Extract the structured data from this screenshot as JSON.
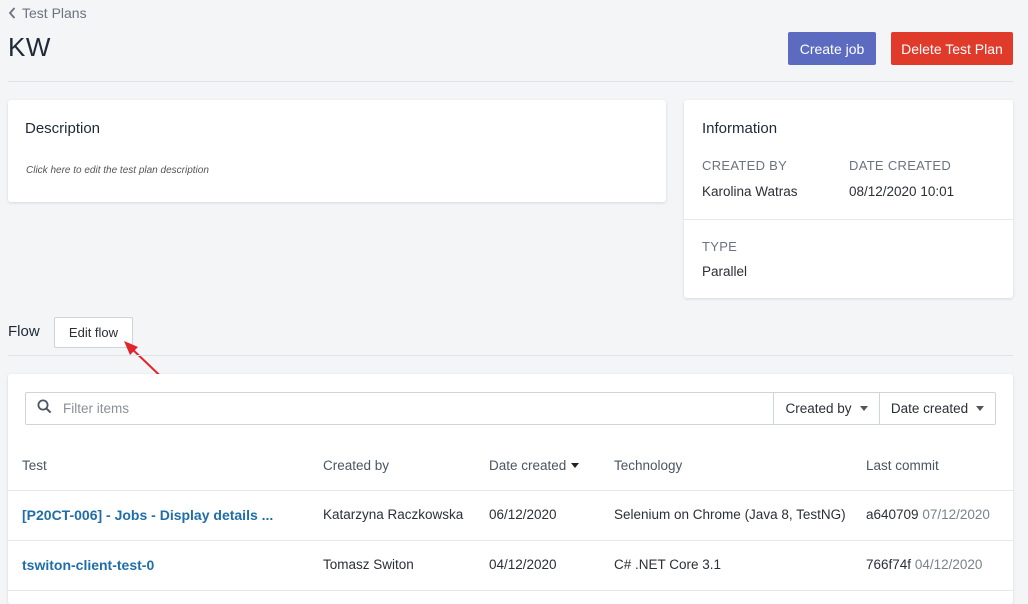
{
  "breadcrumb": {
    "label": "Test Plans"
  },
  "page": {
    "title": "KW"
  },
  "actions": {
    "create_job": "Create job",
    "delete_plan": "Delete Test Plan"
  },
  "colors": {
    "primary": "#5c6bc0",
    "danger": "#e03a2a",
    "link": "#1f6ea8",
    "annotation_arrow": "#e0252d"
  },
  "description": {
    "title": "Description",
    "hint": "Click here to edit the test plan description"
  },
  "information": {
    "title": "Information",
    "created_by_label": "CREATED BY",
    "created_by_value": "Karolina Watras",
    "date_created_label": "DATE CREATED",
    "date_created_value": "08/12/2020 10:01",
    "type_label": "TYPE",
    "type_value": "Parallel"
  },
  "flow": {
    "label": "Flow",
    "edit_button": "Edit flow"
  },
  "filter": {
    "placeholder": "Filter items",
    "created_by": "Created by",
    "date_created": "Date created"
  },
  "table": {
    "columns": {
      "test": "Test",
      "created_by": "Created by",
      "date_created": "Date created",
      "technology": "Technology",
      "last_commit": "Last commit"
    },
    "rows": [
      {
        "test": "[P20CT-006] - Jobs - Display details ...",
        "created_by": "Katarzyna Raczkowska",
        "date_created": "06/12/2020",
        "technology": "Selenium on Chrome (Java 8, TestNG)",
        "commit_hash": "a640709",
        "commit_date": "07/12/2020"
      },
      {
        "test": "tswiton-client-test-0",
        "created_by": "Tomasz Switon",
        "date_created": "04/12/2020",
        "technology": "C# .NET Core 3.1",
        "commit_hash": "766f74f",
        "commit_date": "04/12/2020"
      }
    ]
  }
}
